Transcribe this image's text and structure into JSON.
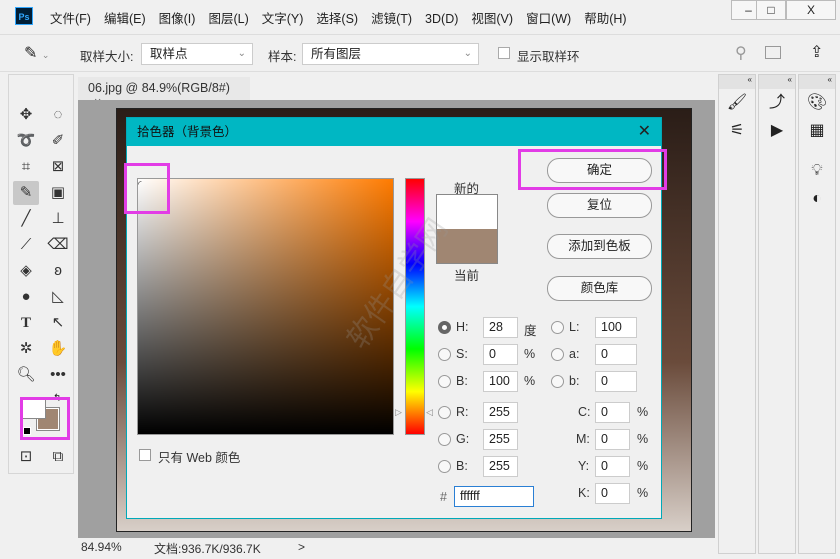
{
  "app": {
    "logo": "Ps"
  },
  "menu": [
    "文件(F)",
    "编辑(E)",
    "图像(I)",
    "图层(L)",
    "文字(Y)",
    "选择(S)",
    "滤镜(T)",
    "3D(D)",
    "视图(V)",
    "窗口(W)",
    "帮助(H)"
  ],
  "window_controls": {
    "minimize": "‒",
    "maximize": "□",
    "close": "X"
  },
  "options": {
    "sample_size_label": "取样大小:",
    "sample_size_value": "取样点",
    "sample_label": "样本:",
    "sample_value": "所有图层",
    "show_ring_label": "显示取样环",
    "show_ring_checked": false
  },
  "document": {
    "tab": "06.jpg @ 84.9%(RGB/8#)",
    "close": "×"
  },
  "status": {
    "zoom": "84.94%",
    "doc": "文档:936.7K/936.7K",
    "arrow": ">"
  },
  "dialog": {
    "title": "拾色器（背景色）",
    "close": "✕",
    "new_label": "新的",
    "current_label": "当前",
    "new_color": "#ffffff",
    "current_color": "#a08672",
    "buttons": {
      "ok": "确定",
      "reset": "复位",
      "add_swatch": "添加到色板",
      "library": "颜色库"
    },
    "web_only": "只有 Web 颜色",
    "hsb": {
      "h_label": "H:",
      "h": "28",
      "h_unit": "度",
      "s_label": "S:",
      "s": "0",
      "s_unit": "%",
      "b_label": "B:",
      "b": "100",
      "b_unit": "%"
    },
    "lab": {
      "l_label": "L:",
      "l": "100",
      "a_label": "a:",
      "a": "0",
      "b_label": "b:",
      "b": "0"
    },
    "rgb": {
      "r_label": "R:",
      "r": "255",
      "g_label": "G:",
      "g": "255",
      "b_label": "B:",
      "b": "255"
    },
    "cmyk": {
      "c_label": "C:",
      "c": "0",
      "m_label": "M:",
      "m": "0",
      "y_label": "Y:",
      "y": "0",
      "k_label": "K:",
      "k": "0",
      "unit": "%"
    },
    "hex_label": "#",
    "hex": "ffffff"
  },
  "watermark": "软件自学网",
  "colors": {
    "foreground": "#ffffff",
    "background": "#a08672",
    "highlight": "#e23ce6",
    "title_bar": "#00b7c3"
  }
}
